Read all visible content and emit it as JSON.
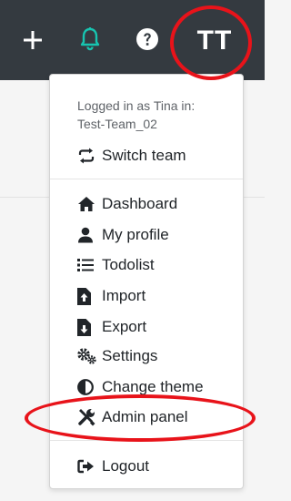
{
  "topbar": {
    "icons": [
      "plus-icon",
      "bell-icon",
      "help-icon"
    ],
    "avatar_initials": "TT",
    "colors": {
      "background": "#343a40",
      "bell": "#17c4b0",
      "foreground": "#ffffff"
    }
  },
  "menu": {
    "logged_in_line": "Logged in as Tina in:",
    "team_name": "Test-Team_02",
    "switch_team": {
      "label": "Switch team",
      "icon": "switch-arrows-icon"
    },
    "items": [
      {
        "label": "Dashboard",
        "icon": "home-icon"
      },
      {
        "label": "My profile",
        "icon": "user-icon"
      },
      {
        "label": "Todolist",
        "icon": "list-icon"
      },
      {
        "label": "Import",
        "icon": "file-import-icon"
      },
      {
        "label": "Export",
        "icon": "file-export-icon"
      },
      {
        "label": "Settings",
        "icon": "gears-icon"
      },
      {
        "label": "Change theme",
        "icon": "half-circle-icon"
      },
      {
        "label": "Admin panel",
        "icon": "tools-icon"
      }
    ],
    "logout": {
      "label": "Logout",
      "icon": "sign-out-icon"
    }
  },
  "annotations": {
    "color": "#e8131a"
  }
}
